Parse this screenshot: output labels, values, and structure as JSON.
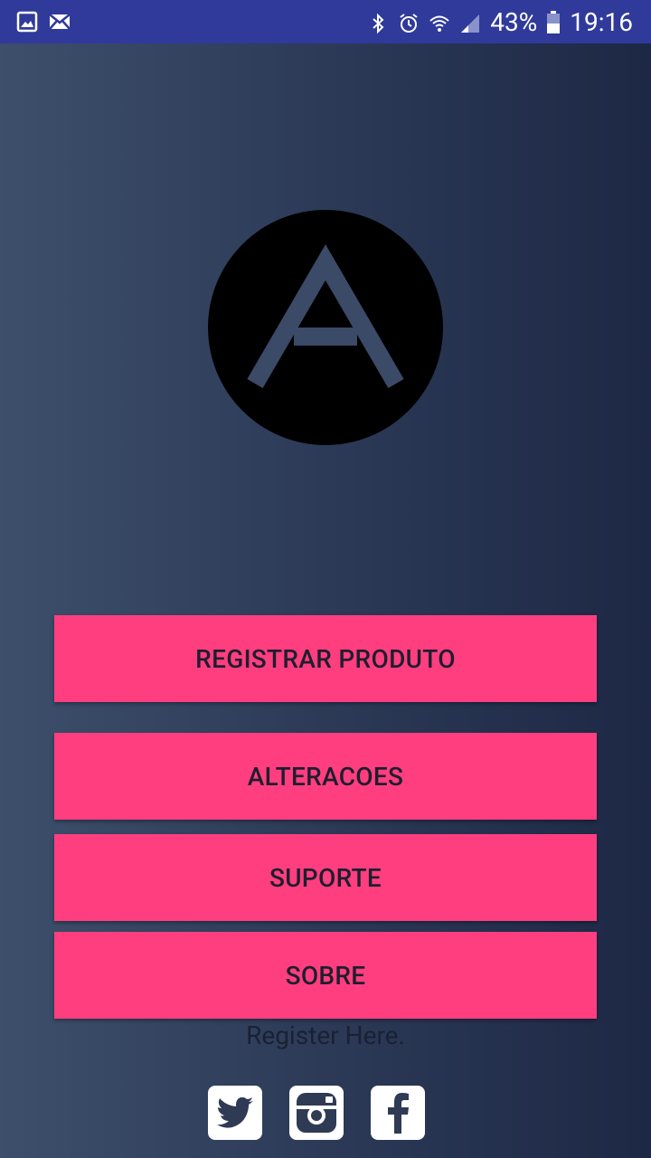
{
  "status_bar": {
    "battery": "43%",
    "time": "19:16",
    "icons": [
      "image-icon",
      "mail-icon",
      "bluetooth-icon",
      "alarm-icon",
      "wifi-icon",
      "signal-icon",
      "battery-icon"
    ]
  },
  "logo": {
    "letter": "A"
  },
  "buttons": {
    "registrar": "REGISTRAR PRODUTO",
    "alteracoes": "ALTERACOES",
    "suporte": "SUPORTE",
    "sobre": "SOBRE"
  },
  "register_link": "Register Here.",
  "social": [
    "twitter-icon",
    "instagram-icon",
    "facebook-icon"
  ],
  "colors": {
    "status_bar": "#2f3a9b",
    "button_bg": "#ff3e7f",
    "button_text": "#1e1e2e",
    "bg_left": "#3d4f6b",
    "bg_right": "#1d2845"
  }
}
